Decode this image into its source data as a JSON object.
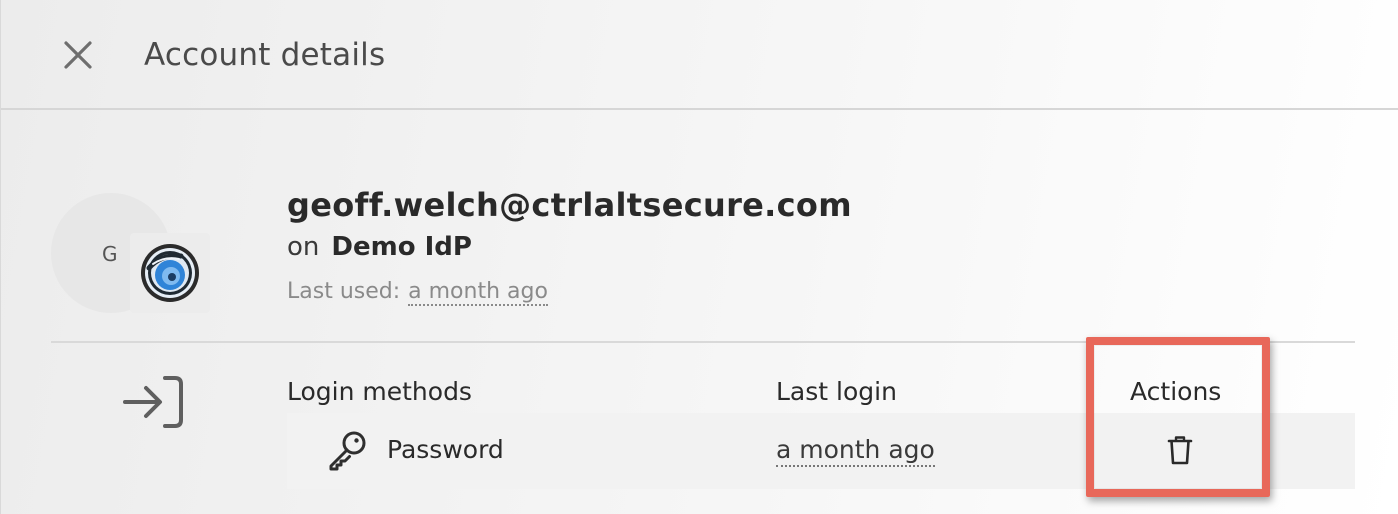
{
  "header": {
    "title": "Account details",
    "close_icon": "close-icon"
  },
  "account": {
    "avatar_initial": "G",
    "email": "geoff.welch@ctrlaltsecure.com",
    "idp_prefix": "on",
    "idp_name": "Demo IdP",
    "last_used_label": "Last used:",
    "last_used_value": "a month ago"
  },
  "login_table": {
    "section_icon": "sign-in-icon",
    "columns": {
      "methods": "Login methods",
      "last_login": "Last login",
      "actions": "Actions"
    },
    "rows": [
      {
        "method_icon": "key-icon",
        "method": "Password",
        "last_login": "a month ago",
        "action_icon": "trash-icon"
      }
    ]
  },
  "colors": {
    "highlight": "#e8685a",
    "logo_blue": "#3c8fe0"
  }
}
